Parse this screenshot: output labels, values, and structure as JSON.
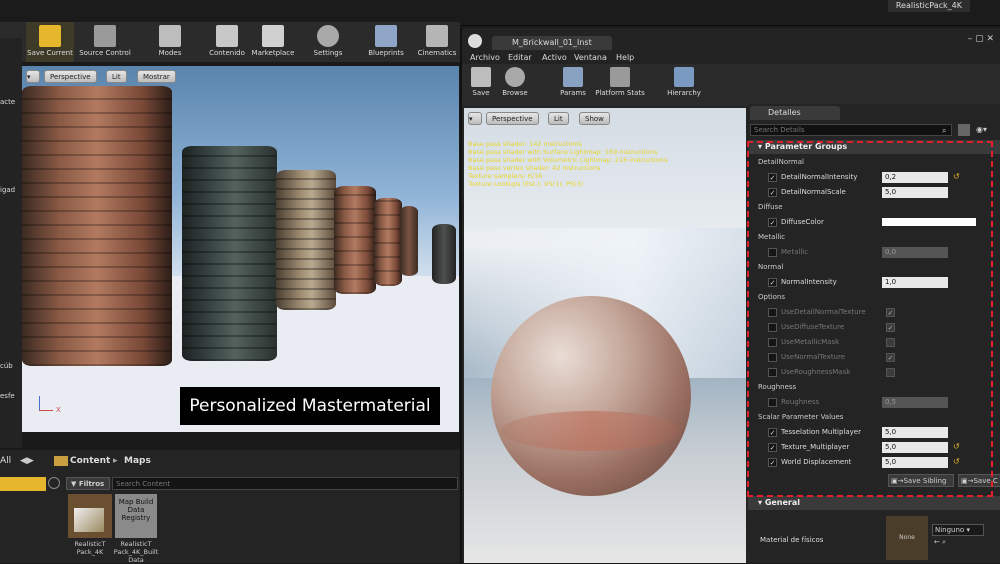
{
  "title_bar": {
    "project_name": "RealisticPack_4K"
  },
  "main_toolbar": {
    "buttons": [
      {
        "label": "Save Current",
        "icon": "save-icon"
      },
      {
        "label": "Source Control",
        "icon": "source-control-icon"
      },
      {
        "label": "Modes",
        "icon": "modes-icon"
      },
      {
        "label": "Contenido",
        "icon": "content-icon"
      },
      {
        "label": "Marketplace",
        "icon": "marketplace-icon"
      },
      {
        "label": "Settings",
        "icon": "gear-icon"
      },
      {
        "label": "Blueprints",
        "icon": "blueprints-icon"
      },
      {
        "label": "Cinematics",
        "icon": "clapper-icon"
      }
    ]
  },
  "left_strip": {
    "fragments": [
      "acte",
      "igad",
      "cúb",
      "esfe"
    ]
  },
  "level_viewport": {
    "perspective": "Perspective",
    "lit": "Lit",
    "show": "Mostrar",
    "caption": "Personalized Mastermaterial",
    "axis_label": "X"
  },
  "content_browser": {
    "all_label": "All",
    "breadcrumb": [
      "Content",
      "Maps"
    ],
    "filters": "Filtros",
    "search_placeholder": "Search Content",
    "assets": [
      {
        "thumb_text": "",
        "name": "RealisticT Pack_4K"
      },
      {
        "thumb_text": "Map Build Data Registry",
        "name": "RealisticT Pack_4K_Built Data"
      }
    ]
  },
  "material_editor": {
    "tab": "M_Brickwall_01_Inst",
    "menu": [
      "Archivo",
      "Editar",
      "Activo",
      "Ventana",
      "Help"
    ],
    "tools": [
      {
        "label": "Save",
        "icon": "save-icon"
      },
      {
        "label": "Browse",
        "icon": "browse-icon"
      },
      {
        "label": "Params",
        "icon": "params-icon"
      },
      {
        "label": "Platform Stats",
        "icon": "platform-stats-icon"
      },
      {
        "label": "Hierarchy",
        "icon": "hierarchy-icon"
      }
    ],
    "viewport": {
      "perspective": "Perspective",
      "lit": "Lit",
      "show": "Show",
      "stats": [
        "Base pass shader: 142 instructions",
        "Base pass shader with Surface Lightmap: 169 instructions",
        "Base pass shader with Volumetric Lightmap: 216 instructions",
        "Base pass vertex shader: 42 instructions",
        "Texture samplers: 6/16",
        "Texture Lookups (Est.): VS(1), PS(3)"
      ]
    },
    "details": {
      "tab": "Detalles",
      "search_placeholder": "Search Details",
      "parameter_groups_title": "Parameter Groups",
      "groups": [
        {
          "name": "DetailNormal",
          "params": [
            {
              "label": "DetailNormalIntensity",
              "checked": true,
              "value": "0,2",
              "reset": true
            },
            {
              "label": "DetailNormalScale",
              "checked": true,
              "value": "5,0",
              "reset": false
            }
          ]
        },
        {
          "name": "Diffuse",
          "params": [
            {
              "label": "DiffuseColor",
              "checked": true,
              "value": "",
              "color": "#ffffff"
            }
          ]
        },
        {
          "name": "Metallic",
          "params": [
            {
              "label": "Metallic",
              "checked": false,
              "value": "0,0",
              "disabled": true
            }
          ]
        },
        {
          "name": "Normal",
          "params": [
            {
              "label": "NormalIntensity",
              "checked": true,
              "value": "1,0"
            }
          ]
        },
        {
          "name": "Options",
          "params": [
            {
              "label": "UseDetailNormalTexture",
              "checked": false,
              "right_checked": true
            },
            {
              "label": "UseDiffuseTexture",
              "checked": false,
              "right_checked": true
            },
            {
              "label": "UseMetallicMask",
              "checked": false,
              "right_checked": false
            },
            {
              "label": "UseNormalTexture",
              "checked": false,
              "right_checked": true
            },
            {
              "label": "UseRoughnessMask",
              "checked": false,
              "right_checked": false
            }
          ]
        },
        {
          "name": "Roughness",
          "params": [
            {
              "label": "Roughness",
              "checked": false,
              "value": "0,5",
              "disabled": true
            }
          ]
        },
        {
          "name": "Scalar Parameter Values",
          "params": [
            {
              "label": "Tesselation Multiplayer",
              "checked": true,
              "value": "5,0"
            },
            {
              "label": "Texture_Multiplayer",
              "checked": true,
              "value": "5,0",
              "reset": true
            },
            {
              "label": "World Displacement",
              "checked": true,
              "value": "5,0",
              "reset": true
            }
          ]
        }
      ],
      "save_sibling": "Save Sibling",
      "save_child": "Save C",
      "general_title": "General",
      "phys_material_label": "Material de físicos",
      "phys_material_thumb": "None",
      "phys_material_value": "Ninguno"
    }
  }
}
